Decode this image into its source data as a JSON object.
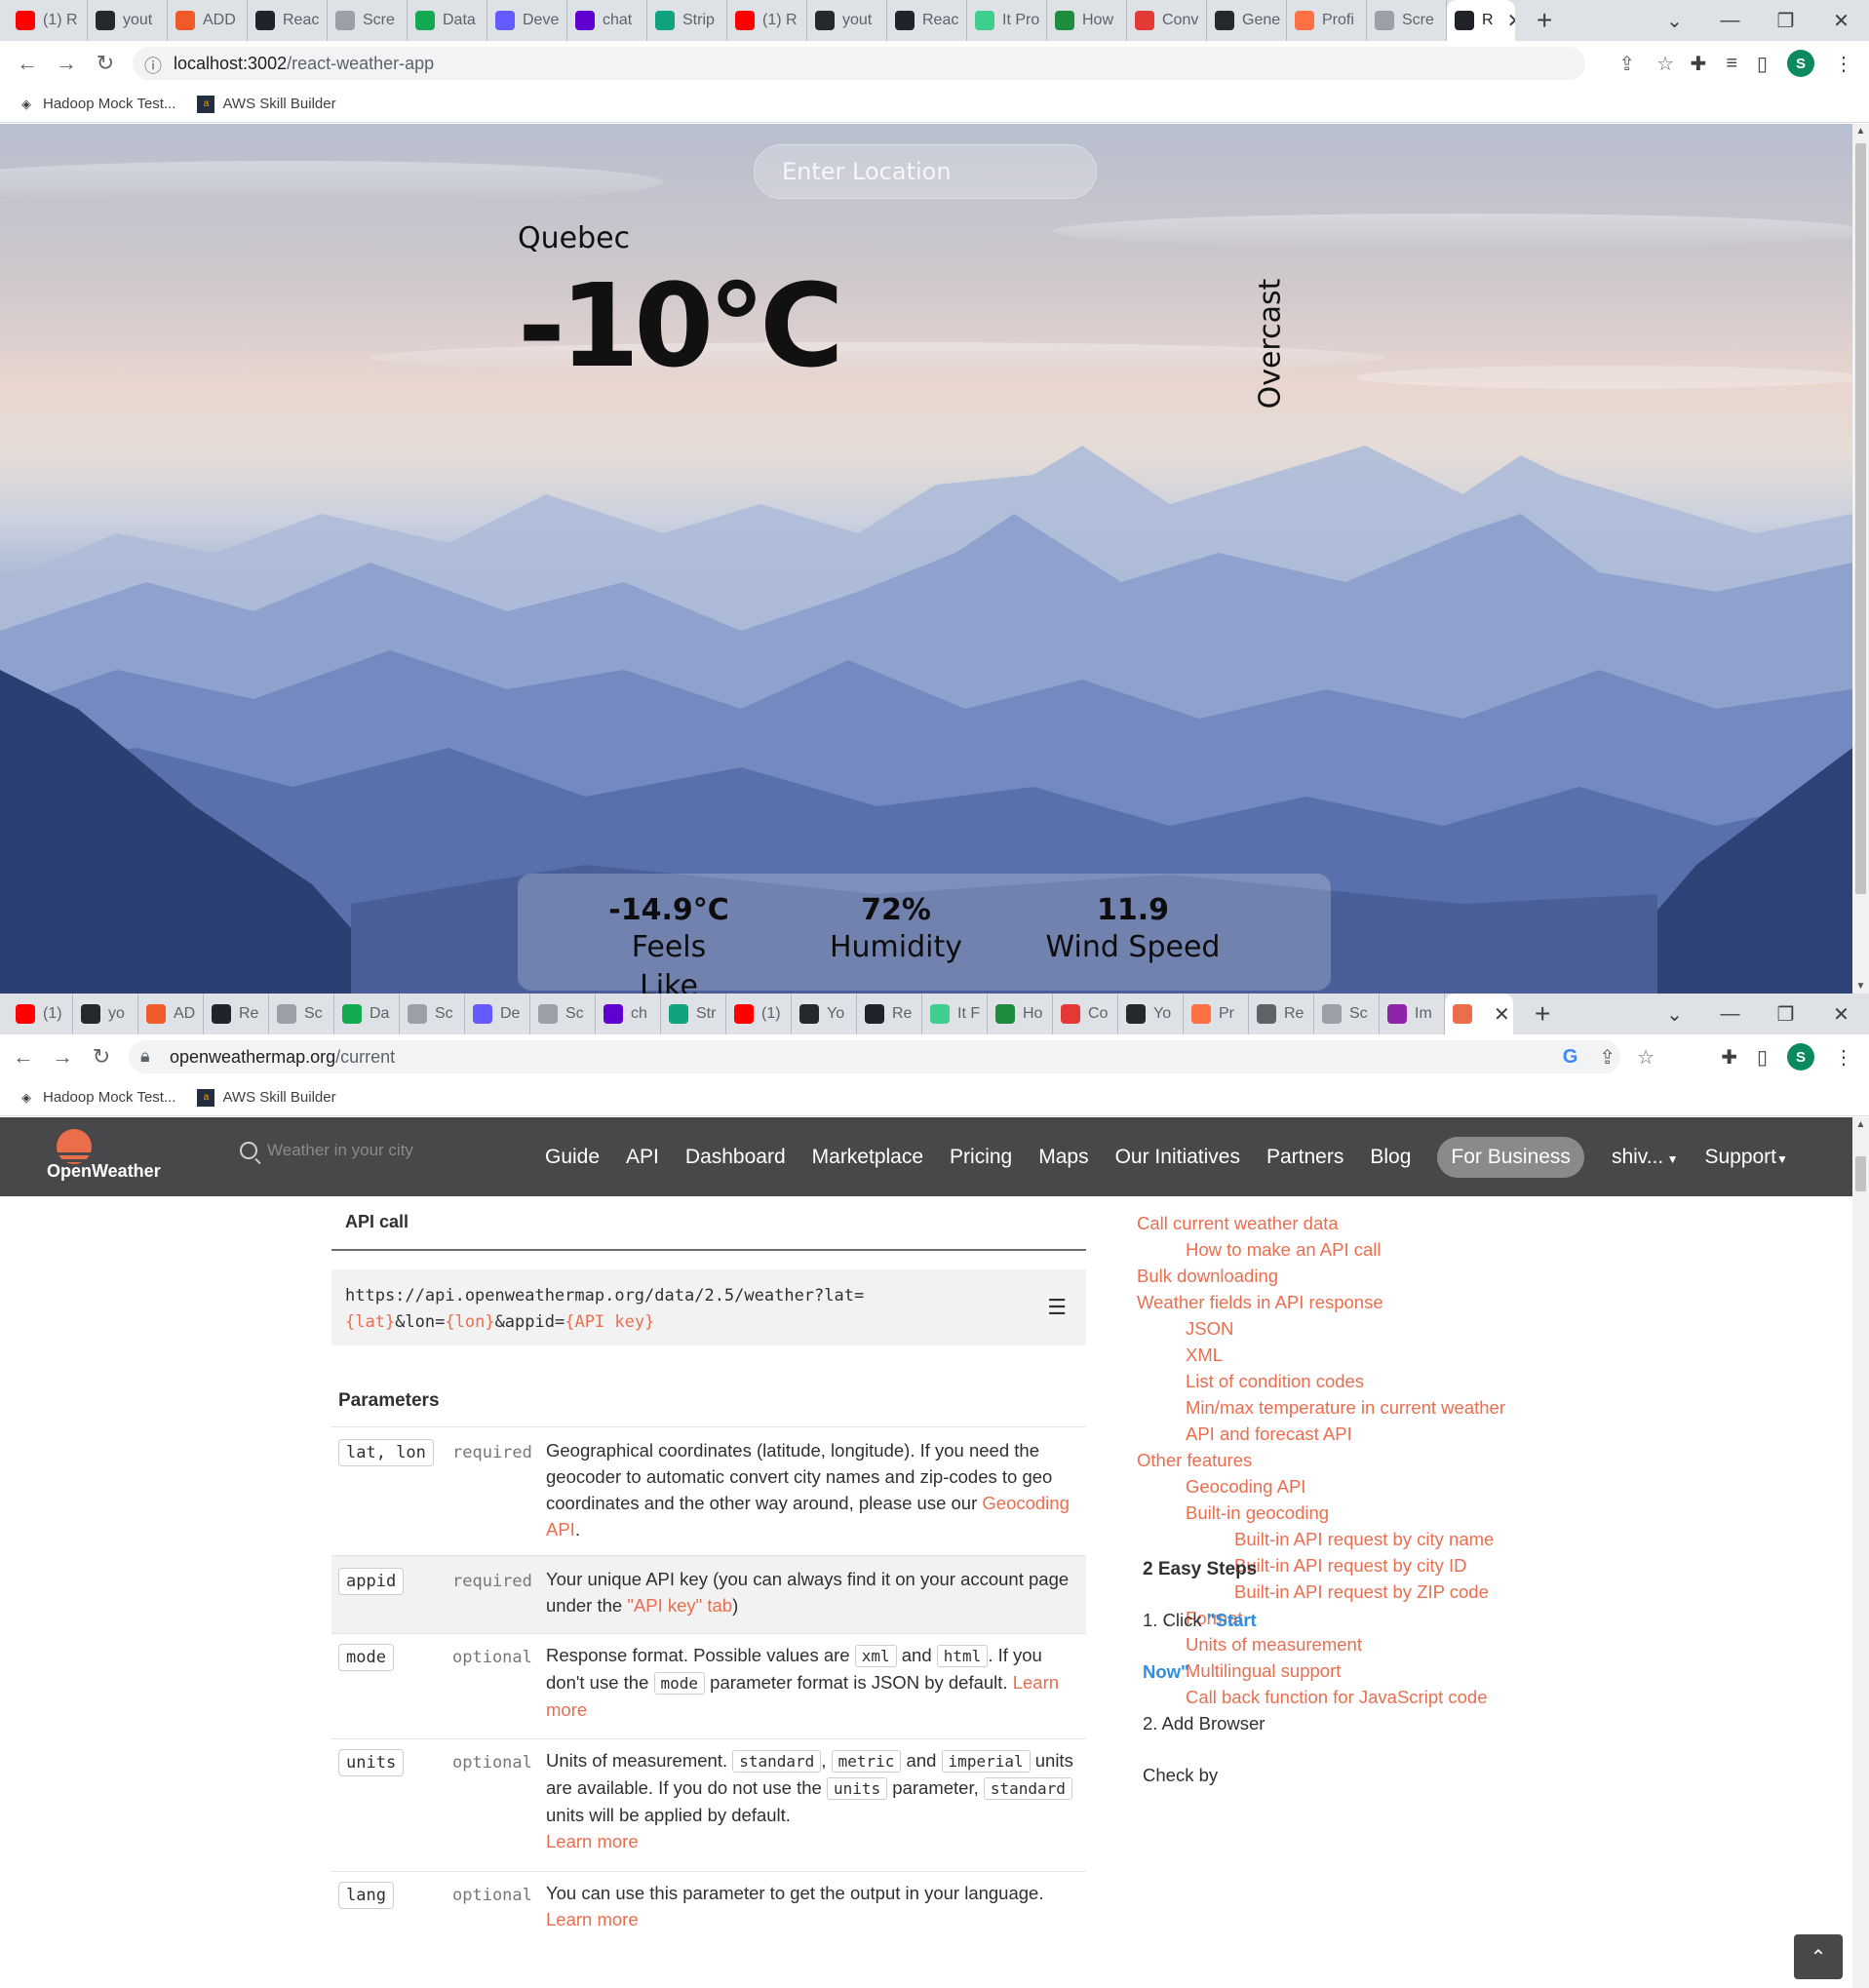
{
  "window1": {
    "tabs": [
      {
        "label": "(1) R",
        "icon": "youtube-icon",
        "color": "#ff0000"
      },
      {
        "label": "yout",
        "icon": "github-icon",
        "color": "#24292e"
      },
      {
        "label": "ADD",
        "icon": "add-icon",
        "color": "#f05a28"
      },
      {
        "label": "Reac",
        "icon": "react-icon",
        "color": "#20232a"
      },
      {
        "label": "Scre",
        "icon": "camera-icon",
        "color": "#9aa0a6"
      },
      {
        "label": "Data",
        "icon": "mongodb-icon",
        "color": "#13aa52"
      },
      {
        "label": "Deve",
        "icon": "s-icon",
        "color": "#635bff"
      },
      {
        "label": "chat",
        "icon": "yahoo-icon",
        "color": "#6001d2"
      },
      {
        "label": "Strip",
        "icon": "openai-icon",
        "color": "#10a37f"
      },
      {
        "label": "(1) R",
        "icon": "youtube-icon",
        "color": "#ff0000"
      },
      {
        "label": "yout",
        "icon": "github-icon",
        "color": "#24292e"
      },
      {
        "label": "Reac",
        "icon": "react-icon",
        "color": "#20232a"
      },
      {
        "label": "It Pro",
        "icon": "p-icon",
        "color": "#3ecf8e"
      },
      {
        "label": "How",
        "icon": "person-icon",
        "color": "#1e8e3e"
      },
      {
        "label": "Conv",
        "icon": "heart-icon",
        "color": "#e53935"
      },
      {
        "label": "Gene",
        "icon": "github-icon",
        "color": "#24292e"
      },
      {
        "label": "Profi",
        "icon": "flower-icon",
        "color": "#ff7043"
      },
      {
        "label": "Scre",
        "icon": "camera-icon",
        "color": "#9aa0a6"
      }
    ],
    "active_tab": {
      "label": "R",
      "icon": "react-icon"
    },
    "url_host": "localhost:3002",
    "url_path": "/react-weather-app",
    "bookmarks": [
      {
        "label": "Hadoop Mock Test...",
        "icon": "hadoop-icon"
      },
      {
        "label": "AWS Skill Builder",
        "icon": "aws-icon"
      }
    ],
    "profile_initial": "S"
  },
  "weather": {
    "search_placeholder": "Enter Location",
    "city": "Quebec",
    "temperature": "-10°C",
    "description": "Overcast",
    "feels_like_value": "-14.9°C",
    "feels_like_label": "Feels Like",
    "humidity_value": "72%",
    "humidity_label": "Humidity",
    "wind_value": "11.9",
    "wind_label": "Wind Speed"
  },
  "window2": {
    "tabs": [
      {
        "label": "(1)",
        "icon": "youtube-icon",
        "color": "#ff0000"
      },
      {
        "label": "yo",
        "icon": "github-icon",
        "color": "#24292e"
      },
      {
        "label": "AD",
        "icon": "add-icon",
        "color": "#f05a28"
      },
      {
        "label": "Re",
        "icon": "react-icon",
        "color": "#20232a"
      },
      {
        "label": "Sc",
        "icon": "camera-icon",
        "color": "#9aa0a6"
      },
      {
        "label": "Da",
        "icon": "mongodb-icon",
        "color": "#13aa52"
      },
      {
        "label": "Sc",
        "icon": "camera-icon",
        "color": "#9aa0a6"
      },
      {
        "label": "De",
        "icon": "s-icon",
        "color": "#635bff"
      },
      {
        "label": "Sc",
        "icon": "camera-icon",
        "color": "#9aa0a6"
      },
      {
        "label": "ch",
        "icon": "yahoo-icon",
        "color": "#6001d2"
      },
      {
        "label": "Str",
        "icon": "openai-icon",
        "color": "#10a37f"
      },
      {
        "label": "(1)",
        "icon": "youtube-icon",
        "color": "#ff0000"
      },
      {
        "label": "Yo",
        "icon": "github-icon",
        "color": "#24292e"
      },
      {
        "label": "Re",
        "icon": "react-icon",
        "color": "#20232a"
      },
      {
        "label": "It F",
        "icon": "p-icon",
        "color": "#3ecf8e"
      },
      {
        "label": "Ho",
        "icon": "person-icon",
        "color": "#1e8e3e"
      },
      {
        "label": "Co",
        "icon": "heart-icon",
        "color": "#e53935"
      },
      {
        "label": "Yo",
        "icon": "github-icon",
        "color": "#24292e"
      },
      {
        "label": "Pr",
        "icon": "flower-icon",
        "color": "#ff7043"
      },
      {
        "label": "Re",
        "icon": "globe-icon",
        "color": "#5f6368"
      },
      {
        "label": "Sc",
        "icon": "camera-icon",
        "color": "#9aa0a6"
      },
      {
        "label": "Im",
        "icon": "jpg-icon",
        "color": "#8e24aa"
      }
    ],
    "active_tab": {
      "label": "",
      "icon": "openweather-icon"
    },
    "url_host": "openweathermap.org",
    "url_path": "/current",
    "bookmarks": [
      {
        "label": "Hadoop Mock Test...",
        "icon": "hadoop-icon"
      },
      {
        "label": "AWS Skill Builder",
        "icon": "aws-icon"
      }
    ],
    "profile_initial": "S"
  },
  "openweather": {
    "logo_text": "OpenWeather",
    "search_placeholder": "Weather in your city",
    "nav": [
      "Guide",
      "API",
      "Dashboard",
      "Marketplace",
      "Pricing",
      "Maps",
      "Our Initiatives",
      "Partners",
      "Blog"
    ],
    "for_business": "For Business",
    "user": "shiv...",
    "support": "Support",
    "api_call_title": "API call",
    "code_line1": "https://api.openweathermap.org/data/2.5/weather?lat=",
    "code_lat": "{lat}",
    "code_lon_prefix": "&lon=",
    "code_lon": "{lon}",
    "code_appid_prefix": "&appid=",
    "code_key": "{API key}",
    "parameters_title": "Parameters",
    "params": {
      "latlon": {
        "name": "lat, lon",
        "req": "required",
        "text": "Geographical coordinates (latitude, longitude). If you need the geocoder to automatic convert city names and zip-codes to geo coordinates and the other way around, please use our ",
        "link": "Geocoding API",
        "end": "."
      },
      "appid": {
        "name": "appid",
        "req": "required",
        "text": "Your unique API key (you can always find it on your account page under the ",
        "link": "\"API key\" tab",
        "end": ")"
      },
      "mode": {
        "name": "mode",
        "req": "optional",
        "t1": "Response format. Possible values are ",
        "c1": "xml",
        "t2": " and ",
        "c2": "html",
        "t3": ". If you don't use the ",
        "c3": "mode",
        "t4": " parameter format is JSON by default. ",
        "link": "Learn more"
      },
      "units": {
        "name": "units",
        "req": "optional",
        "t1": "Units of measurement. ",
        "c1": "standard",
        "t2": ", ",
        "c2": "metric",
        "t3": " and ",
        "c3": "imperial",
        "t4": " units are available. If you do not use the ",
        "c4": "units",
        "t5": " parameter, ",
        "c5": "standard",
        "t6": " units will be applied by default.",
        "link": "Learn more"
      },
      "lang": {
        "name": "lang",
        "req": "optional",
        "text": "You can use this parameter to get the output in your language.",
        "link": "Learn more"
      }
    },
    "toc": [
      "Call current weather data",
      "How to make an API call",
      "Bulk downloading",
      "Weather fields in API response",
      "JSON",
      "XML",
      "List of condition codes",
      "Min/max temperature in current weather",
      "API and forecast API",
      "Other features",
      "Geocoding API",
      "Built-in geocoding",
      "Built-in API request by city name",
      "Built-in API request by city ID",
      "Built-in API request by ZIP code",
      "Format",
      "Units of measurement",
      "Multilingual support",
      "Call back function for JavaScript code"
    ],
    "steps_title": "2 Easy Steps",
    "step1_prefix": "1. Click ",
    "step1_link_a": "\"Start",
    "step1_link_b": "Now\"",
    "step2_a": "2. Add Browser",
    "step2_b": "Check by"
  }
}
